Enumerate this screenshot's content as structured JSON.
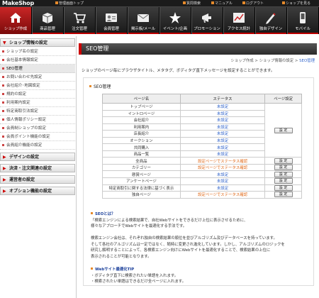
{
  "topbar": {
    "logo": "MakeShop",
    "left_link": "管理画面トップ",
    "links": [
      "質問検索",
      "マニュアル",
      "ログアウト",
      "ショップを見る"
    ]
  },
  "gnav": {
    "items": [
      {
        "label": "ショップ作成",
        "icon": "home-icon"
      },
      {
        "label": "商品管理",
        "icon": "box-icon"
      },
      {
        "label": "注文管理",
        "icon": "cart-icon"
      },
      {
        "label": "会員管理",
        "icon": "member-icon"
      },
      {
        "label": "掲示板/メール",
        "icon": "mail-icon"
      },
      {
        "label": "イベント/企画",
        "icon": "event-icon"
      },
      {
        "label": "プロモーション",
        "icon": "promotion-icon"
      },
      {
        "label": "アクセス統計",
        "icon": "chart-icon"
      },
      {
        "label": "独自デザイン",
        "icon": "design-icon"
      },
      {
        "label": "モバイル",
        "icon": "mobile-icon"
      }
    ]
  },
  "sidebar": {
    "section1": "ショップ情報の設定",
    "items": [
      "ショップ名の設定",
      "会社基本情報設定",
      "SEO管理",
      "お問い合わせ先設定",
      "会社紹介･地図設定",
      "規約の設定",
      "利用案内設定",
      "特定商取引法設定",
      "個人情報ポリシー設定",
      "会員制ショップの設定",
      "会員ポイント機能の設定",
      "会員紹介機能の設定"
    ],
    "sections": [
      "デザインの設定",
      "決済・注文関連の設定",
      "運営者の設定",
      "オプション機能の設定"
    ]
  },
  "main": {
    "title": "SEO管理",
    "breadcrumb": {
      "p1": "ショップ作成",
      "sep": " > ",
      "p2": "ショップ情報の設定",
      "current": "SEO管理"
    },
    "description": "ショップのページ毎にブラウザタイトル、メタタグ、ボディタグ直下メッセージを設定することができます。",
    "section_title": "SEO管理",
    "table": {
      "headers": [
        "ページ名",
        "ステータス",
        "ページ設定"
      ],
      "rows": [
        {
          "page": "トップページ",
          "status": "未設定"
        },
        {
          "page": "イントロページ",
          "status": "未設定"
        },
        {
          "page": "会社紹介",
          "status": "未設定"
        },
        {
          "page": "利用案内",
          "status": "未設定"
        },
        {
          "page": "店長紹介",
          "status": "未設定"
        },
        {
          "page": "オークション",
          "status": "未設定"
        },
        {
          "page": "共同購入",
          "status": "未設定"
        },
        {
          "page": "商品一覧",
          "status": "未設定"
        },
        {
          "page": "全商品",
          "status": "設定ページでステータス確認"
        },
        {
          "page": "カテゴリー",
          "status": "設定ページでステータス確認"
        },
        {
          "page": "懸賞ページ",
          "status": "未設定"
        },
        {
          "page": "アンケートページ",
          "status": "未設定"
        },
        {
          "page": "特定商取引に関する法律に基づく表示",
          "status": "未設定"
        },
        {
          "page": "独自ページ",
          "status": "設定ページでステータス確認"
        }
      ],
      "button_label": "設 定"
    },
    "seo_about": {
      "heading": "SEOとは？",
      "lines": [
        "「検索エンジンによる検索結果で、自社Webサイトをできるだけ上位に表示させるために、",
        "様々なアプローチでWebサイトを最適化する手法です。"
      ]
    },
    "engine_text": [
      "検索エンジン会社は、それぞれ独自の検索結果の順位を並びアルゴリズム及びデータベースを持っています。",
      "そして各社のアルゴリズムは一定ではなく、随時に変更され進化しています。しかし、アルゴリズムのロジックを",
      "研究し解明することによって、各検索エンジン向けにWebサイトを最適化することで、検索結果の上位に",
      "表示されることが可能となります。"
    ],
    "tip": {
      "heading": "Webサイト最適化TIP",
      "lines": [
        "ボディタグ直下に検索されたい単語を入れます。",
        "検索されたい単語はできるだけ全ページに入れます。"
      ]
    }
  }
}
